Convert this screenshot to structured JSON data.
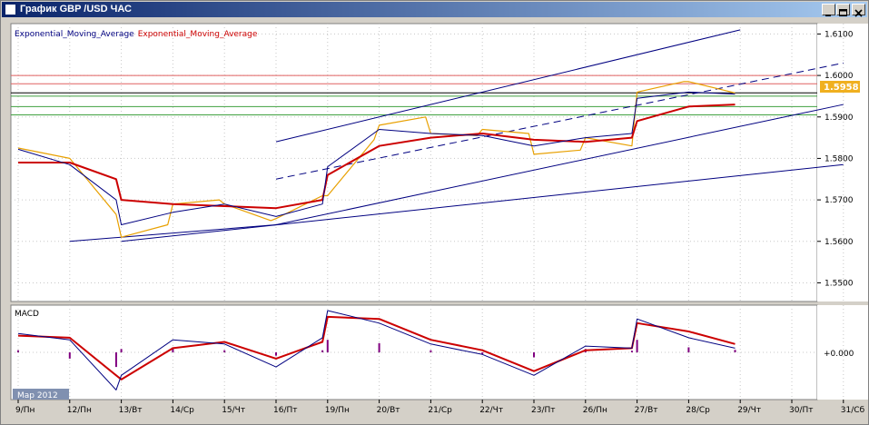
{
  "window": {
    "title": "График GBP /USD  ЧАС",
    "buttons": [
      "minimize",
      "maximize",
      "close"
    ]
  },
  "chart_data": {
    "type": "line",
    "symbol": "GBP/USD",
    "timeframe": "H1",
    "indicator_labels": [
      {
        "text": "Exponential_Moving_Average",
        "color": "#000080"
      },
      {
        "text": "Exponential_Moving_Average",
        "color": "#cc0000"
      }
    ],
    "y_ticks": [
      "1.6100",
      "1.6000",
      "1.5900",
      "1.5800",
      "1.5700",
      "1.5600",
      "1.5500"
    ],
    "y_range": [
      1.5455,
      1.6125
    ],
    "current_price": "1.5958",
    "x_ticks": [
      "9/Пн",
      "12/Пн",
      "13/Вт",
      "14/Ср",
      "15/Чт",
      "16/Пт",
      "19/Пн",
      "20/Вт",
      "21/Ср",
      "22/Чт",
      "23/Пт",
      "26/Пн",
      "27/Вт",
      "28/Ср",
      "29/Чт",
      "30/Пт",
      "31/Сб"
    ],
    "date_badge": "Мар 2012",
    "horizontal_levels": [
      {
        "value": 1.6,
        "color": "#e06060"
      },
      {
        "value": 1.598,
        "color": "#e06060"
      },
      {
        "value": 1.5958,
        "color": "#000000"
      },
      {
        "value": 1.595,
        "color": "#40a040"
      },
      {
        "value": 1.5925,
        "color": "#40a040"
      },
      {
        "value": 1.5905,
        "color": "#40a040"
      }
    ],
    "trend_lines": [
      {
        "from": [
          "12/Пн",
          1.56
        ],
        "to": [
          "16/Пт",
          1.564
        ],
        "style": "solid"
      },
      {
        "from": [
          "16/Пт",
          1.564
        ],
        "to": [
          "31/Сб",
          1.593
        ],
        "style": "solid"
      },
      {
        "from": [
          "13/Вт",
          1.56
        ],
        "to": [
          "31/Сб",
          1.5785
        ],
        "style": "solid"
      },
      {
        "from": [
          "16/Пт",
          1.584
        ],
        "to": [
          "29/Чт",
          1.611
        ],
        "style": "solid"
      },
      {
        "from": [
          "16/Пт",
          1.575
        ],
        "to": [
          "31/Сб",
          1.603
        ],
        "style": "dashed"
      }
    ],
    "price": [
      [
        "9/Пн",
        1.5825
      ],
      [
        "12/Пн",
        1.58
      ],
      [
        "12/Пн",
        1.5665
      ],
      [
        "13/Вт",
        1.561
      ],
      [
        "13/Вт",
        1.564
      ],
      [
        "14/Ср",
        1.569
      ],
      [
        "14/Ср",
        1.57
      ],
      [
        "15/Чт",
        1.569
      ],
      [
        "15/Чт",
        1.565
      ],
      [
        "16/Пт",
        1.5655
      ],
      [
        "16/Пт",
        1.571
      ],
      [
        "19/Пн",
        1.571
      ],
      [
        "19/Пн",
        1.5845
      ],
      [
        "20/Вт",
        1.588
      ],
      [
        "20/Вт",
        1.59
      ],
      [
        "21/Ср",
        1.586
      ],
      [
        "21/Ср",
        1.5855
      ],
      [
        "22/Чт",
        1.587
      ],
      [
        "22/Чт",
        1.586
      ],
      [
        "23/Пт",
        1.581
      ],
      [
        "23/Пт",
        1.582
      ],
      [
        "26/Пн",
        1.585
      ],
      [
        "26/Пн",
        1.583
      ],
      [
        "27/Вт",
        1.596
      ],
      [
        "27/Вт",
        1.5985
      ],
      [
        "28/Ср",
        1.5985
      ],
      [
        "28/Ср",
        1.5958
      ]
    ],
    "ema_fast": [
      [
        "9/Пн",
        1.5822
      ],
      [
        "12/Пн",
        1.5785
      ],
      [
        "12/Пн",
        1.57
      ],
      [
        "13/Вт",
        1.564
      ],
      [
        "14/Ср",
        1.567
      ],
      [
        "15/Чт",
        1.569
      ],
      [
        "16/Пт",
        1.566
      ],
      [
        "16/Пт",
        1.569
      ],
      [
        "19/Пн",
        1.578
      ],
      [
        "20/Вт",
        1.587
      ],
      [
        "21/Ср",
        1.586
      ],
      [
        "22/Чт",
        1.5855
      ],
      [
        "23/Пт",
        1.583
      ],
      [
        "26/Пн",
        1.585
      ],
      [
        "26/Пн",
        1.586
      ],
      [
        "27/Вт",
        1.5945
      ],
      [
        "28/Ср",
        1.596
      ],
      [
        "28/Ср",
        1.5955
      ]
    ],
    "ema_slow": [
      [
        "9/Пн",
        1.579
      ],
      [
        "12/Пн",
        1.579
      ],
      [
        "12/Пн",
        1.575
      ],
      [
        "13/Вт",
        1.57
      ],
      [
        "14/Ср",
        1.569
      ],
      [
        "15/Чт",
        1.5685
      ],
      [
        "16/Пт",
        1.568
      ],
      [
        "16/Пт",
        1.57
      ],
      [
        "19/Пн",
        1.576
      ],
      [
        "20/Вт",
        1.583
      ],
      [
        "21/Ср",
        1.585
      ],
      [
        "22/Чт",
        1.586
      ],
      [
        "23/Пт",
        1.5845
      ],
      [
        "26/Пн",
        1.584
      ],
      [
        "26/Пн",
        1.585
      ],
      [
        "27/Вт",
        1.589
      ],
      [
        "28/Ср",
        1.5925
      ],
      [
        "28/Ср",
        1.593
      ]
    ],
    "macd": {
      "label": "MACD",
      "zero_label": "+0.000",
      "y_range": [
        -1,
        1
      ],
      "histogram": [
        [
          "9/Пн",
          0.05
        ],
        [
          "12/Пн",
          -0.15
        ],
        [
          "12/Пн",
          -0.35
        ],
        [
          "13/Вт",
          0.08
        ],
        [
          "14/Ср",
          0.12
        ],
        [
          "15/Чт",
          0.05
        ],
        [
          "16/Пт",
          -0.08
        ],
        [
          "16/Пт",
          0.05
        ],
        [
          "19/Пн",
          0.3
        ],
        [
          "20/Вт",
          0.22
        ],
        [
          "21/Ср",
          0.05
        ],
        [
          "22/Чт",
          -0.05
        ],
        [
          "23/Пт",
          -0.12
        ],
        [
          "26/Пн",
          0.08
        ],
        [
          "26/Пн",
          0.04
        ],
        [
          "27/Вт",
          0.3
        ],
        [
          "28/Ср",
          0.12
        ],
        [
          "28/Ср",
          0.06
        ]
      ],
      "signal_fast": [
        [
          "9/Пн",
          0.45
        ],
        [
          "12/Пн",
          0.3
        ],
        [
          "12/Пн",
          -0.9
        ],
        [
          "13/Вт",
          -0.55
        ],
        [
          "14/Ср",
          0.3
        ],
        [
          "15/Чт",
          0.2
        ],
        [
          "16/Пт",
          -0.35
        ],
        [
          "16/Пт",
          0.35
        ],
        [
          "19/Пн",
          1.0
        ],
        [
          "20/Вт",
          0.7
        ],
        [
          "21/Ср",
          0.2
        ],
        [
          "22/Чт",
          -0.05
        ],
        [
          "23/Пт",
          -0.55
        ],
        [
          "26/Пн",
          0.15
        ],
        [
          "26/Пн",
          0.1
        ],
        [
          "27/Вт",
          0.8
        ],
        [
          "28/Ср",
          0.35
        ],
        [
          "28/Ср",
          0.1
        ]
      ],
      "signal_slow": [
        [
          "9/Пн",
          0.4
        ],
        [
          "12/Пн",
          0.35
        ],
        [
          "12/Пн",
          -0.55
        ],
        [
          "13/Вт",
          -0.65
        ],
        [
          "14/Ср",
          0.1
        ],
        [
          "15/Чт",
          0.25
        ],
        [
          "16/Пт",
          -0.15
        ],
        [
          "16/Пт",
          0.25
        ],
        [
          "19/Пн",
          0.85
        ],
        [
          "20/Вт",
          0.8
        ],
        [
          "21/Ср",
          0.3
        ],
        [
          "22/Чт",
          0.05
        ],
        [
          "23/Пт",
          -0.45
        ],
        [
          "26/Пн",
          0.05
        ],
        [
          "26/Пн",
          0.1
        ],
        [
          "27/Вт",
          0.7
        ],
        [
          "28/Ср",
          0.5
        ],
        [
          "28/Ср",
          0.2
        ]
      ]
    }
  }
}
